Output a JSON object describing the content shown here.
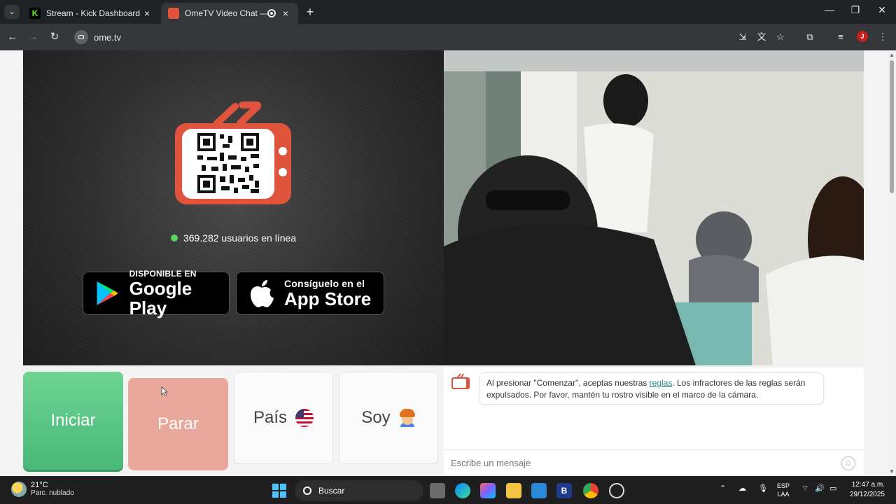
{
  "browser": {
    "tabs": [
      {
        "title": "Stream - Kick Dashboard",
        "favicon_color": "#53fc18"
      },
      {
        "title": "OmeTV Video Chat — Ome",
        "favicon_color": "#e0533d",
        "recording": true
      }
    ],
    "url": "ome.tv",
    "profile_initial": "J"
  },
  "page": {
    "online_count_text": "369.282 usuarios en línea",
    "google_play": {
      "small": "DISPONIBLE EN",
      "big": "Google Play"
    },
    "app_store": {
      "small": "Consíguelo en el",
      "big": "App Store"
    },
    "buttons": {
      "start": "Iniciar",
      "stop": "Parar",
      "country": "País",
      "gender": "Soy"
    },
    "chat": {
      "notice_before": "Al presionar \"Comenzar\", aceptas nuestras ",
      "notice_link": "reglas",
      "notice_after": ". Los infractores de las reglas serán expulsados. Por favor, mantén tu rostro visible en el marco de la cámara.",
      "input_placeholder": "Escribe un mensaje"
    },
    "colors": {
      "brand": "#e0533d",
      "start_green": "#5cc685",
      "stop_pink": "#e8a89b",
      "online_dot": "#58d65a"
    }
  },
  "taskbar": {
    "weather_temp": "21°C",
    "weather_desc": "Parc. nublado",
    "search_label": "Buscar",
    "lang_line1": "ESP",
    "lang_line2": "LAA",
    "time": "12:47 a.m.",
    "date": "29/12/2025"
  }
}
